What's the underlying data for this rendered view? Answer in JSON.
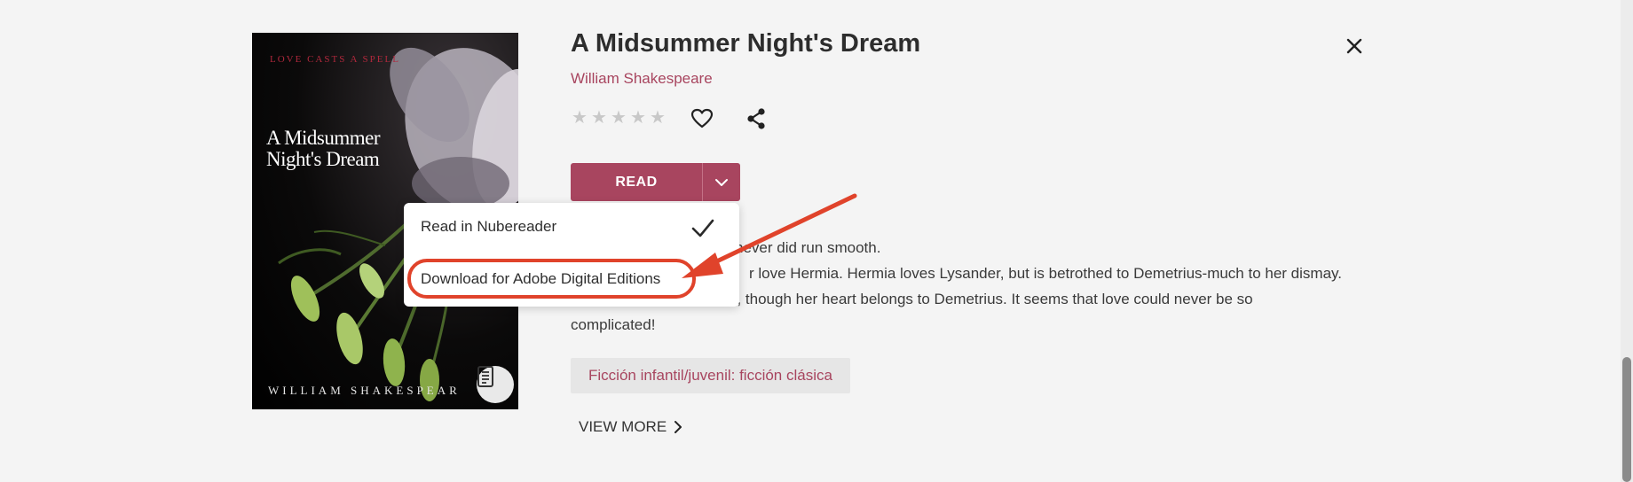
{
  "book": {
    "title": "A Midsummer Night's Dream",
    "author": "William Shakespeare",
    "rating": {
      "value": 0,
      "max": 5
    },
    "cover": {
      "tagline": "Love casts a spell",
      "title": "A Midsummer Night's Dream",
      "author": "WILLIAM SHAKESPEAR"
    }
  },
  "actions": {
    "read_label": "READ"
  },
  "dropdown": {
    "items": [
      {
        "label": "Read in Nubereader",
        "selected": true
      },
      {
        "label": "Download for Adobe Digital Editions",
        "selected": false,
        "highlighted": true
      }
    ]
  },
  "description": {
    "lines": [
      "never did run smooth.",
      "r love Hermia. Hermia loves Lysander, but is betrothed to Demetrius-much to her dismay.",
      "u, though her heart belongs to Demetrius. It seems that love could never be so",
      "complicated!"
    ]
  },
  "tags": [
    "Ficción infantil/juvenil: ficción clásica"
  ],
  "view_more_label": "VIEW MORE",
  "colors": {
    "accent": "#a8455f",
    "annotation": "#e0432b",
    "background": "#f4f4f4"
  },
  "icons": {
    "close": "close-icon",
    "favorite": "heart-icon",
    "share": "share-icon",
    "dropdown": "chevron-down-icon",
    "check": "check-icon",
    "format": "document-icon",
    "view_more": "chevron-right-icon"
  }
}
